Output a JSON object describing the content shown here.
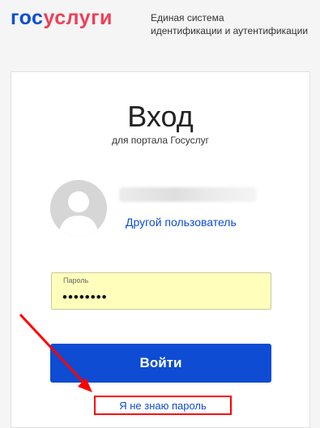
{
  "header": {
    "logo_part1": "гос",
    "logo_part2": "услуги",
    "tagline_line1": "Единая система",
    "tagline_line2": "идентификации и аутентификации"
  },
  "login": {
    "title": "Вход",
    "subtitle": "для портала Госуслуг",
    "other_user_link": "Другой пользователь",
    "password_label": "Пароль",
    "password_value": "••••••••",
    "submit_label": "Войти",
    "forgot_link": "Я не знаю пароль"
  },
  "colors": {
    "brand_blue": "#0d4cd3",
    "brand_red": "#ee3f58",
    "autofill_yellow": "#ffffbb",
    "annotation_red": "#ff0000"
  },
  "icons": {
    "avatar": "user-silhouette-icon",
    "annotation": "red-arrow-icon"
  }
}
